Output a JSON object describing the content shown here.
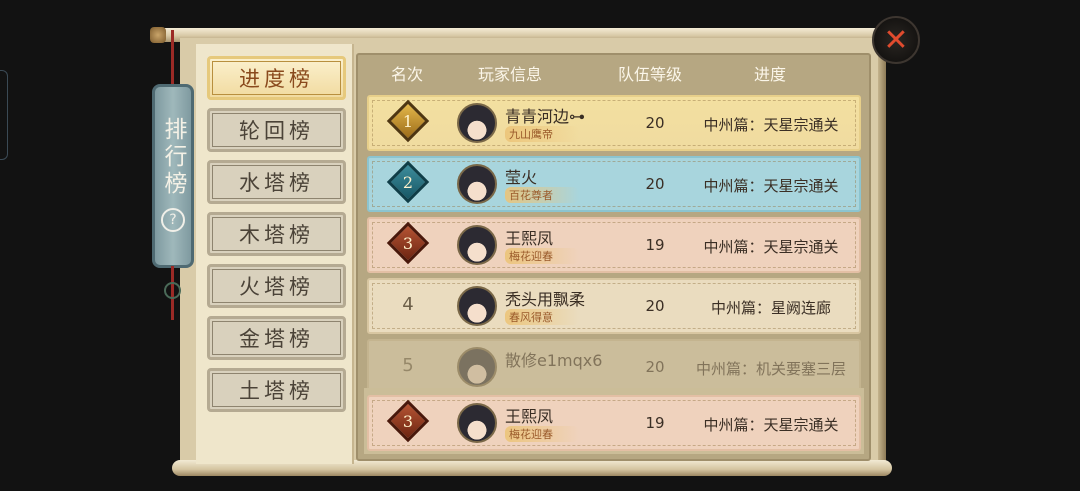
{
  "sidebar": {
    "title": "排行榜",
    "help": "?",
    "tabs": [
      {
        "label": "进度榜",
        "active": true
      },
      {
        "label": "轮回榜"
      },
      {
        "label": "水塔榜"
      },
      {
        "label": "木塔榜"
      },
      {
        "label": "火塔榜"
      },
      {
        "label": "金塔榜"
      },
      {
        "label": "土塔榜"
      }
    ]
  },
  "close": "✕",
  "table": {
    "headers": {
      "rank": "名次",
      "player": "玩家信息",
      "level": "队伍等级",
      "progress": "进度"
    },
    "rows": [
      {
        "rank": "1",
        "name": "青青河边⊶",
        "title": "九山鹰帝",
        "level": "20",
        "progress": "中州篇：天星宗通关",
        "style": "gold"
      },
      {
        "rank": "2",
        "name": "莹火",
        "title": "百花尊者",
        "level": "20",
        "progress": "中州篇：天星宗通关",
        "style": "blue"
      },
      {
        "rank": "3",
        "name": "王熙凤",
        "title": "梅花迎春",
        "level": "19",
        "progress": "中州篇：天星宗通关",
        "style": "pink"
      },
      {
        "rank": "4",
        "name": "秃头用飘柔",
        "title": "春风得意",
        "level": "20",
        "progress": "中州篇：星阙连廊",
        "style": "plain"
      },
      {
        "rank": "5",
        "name": "散修e1mqx6",
        "title": "",
        "level": "20",
        "progress": "中州篇：机关要塞三层",
        "style": "plain"
      }
    ],
    "me": {
      "rank": "3",
      "name": "王熙凤",
      "title": "梅花迎春",
      "level": "19",
      "progress": "中州篇：天星宗通关"
    }
  },
  "colors": {
    "gold_row": "#f3e0a0",
    "blue_row": "#a8d5dd",
    "pink_row": "#efd2bd",
    "plain_row": "#eadcbf"
  }
}
